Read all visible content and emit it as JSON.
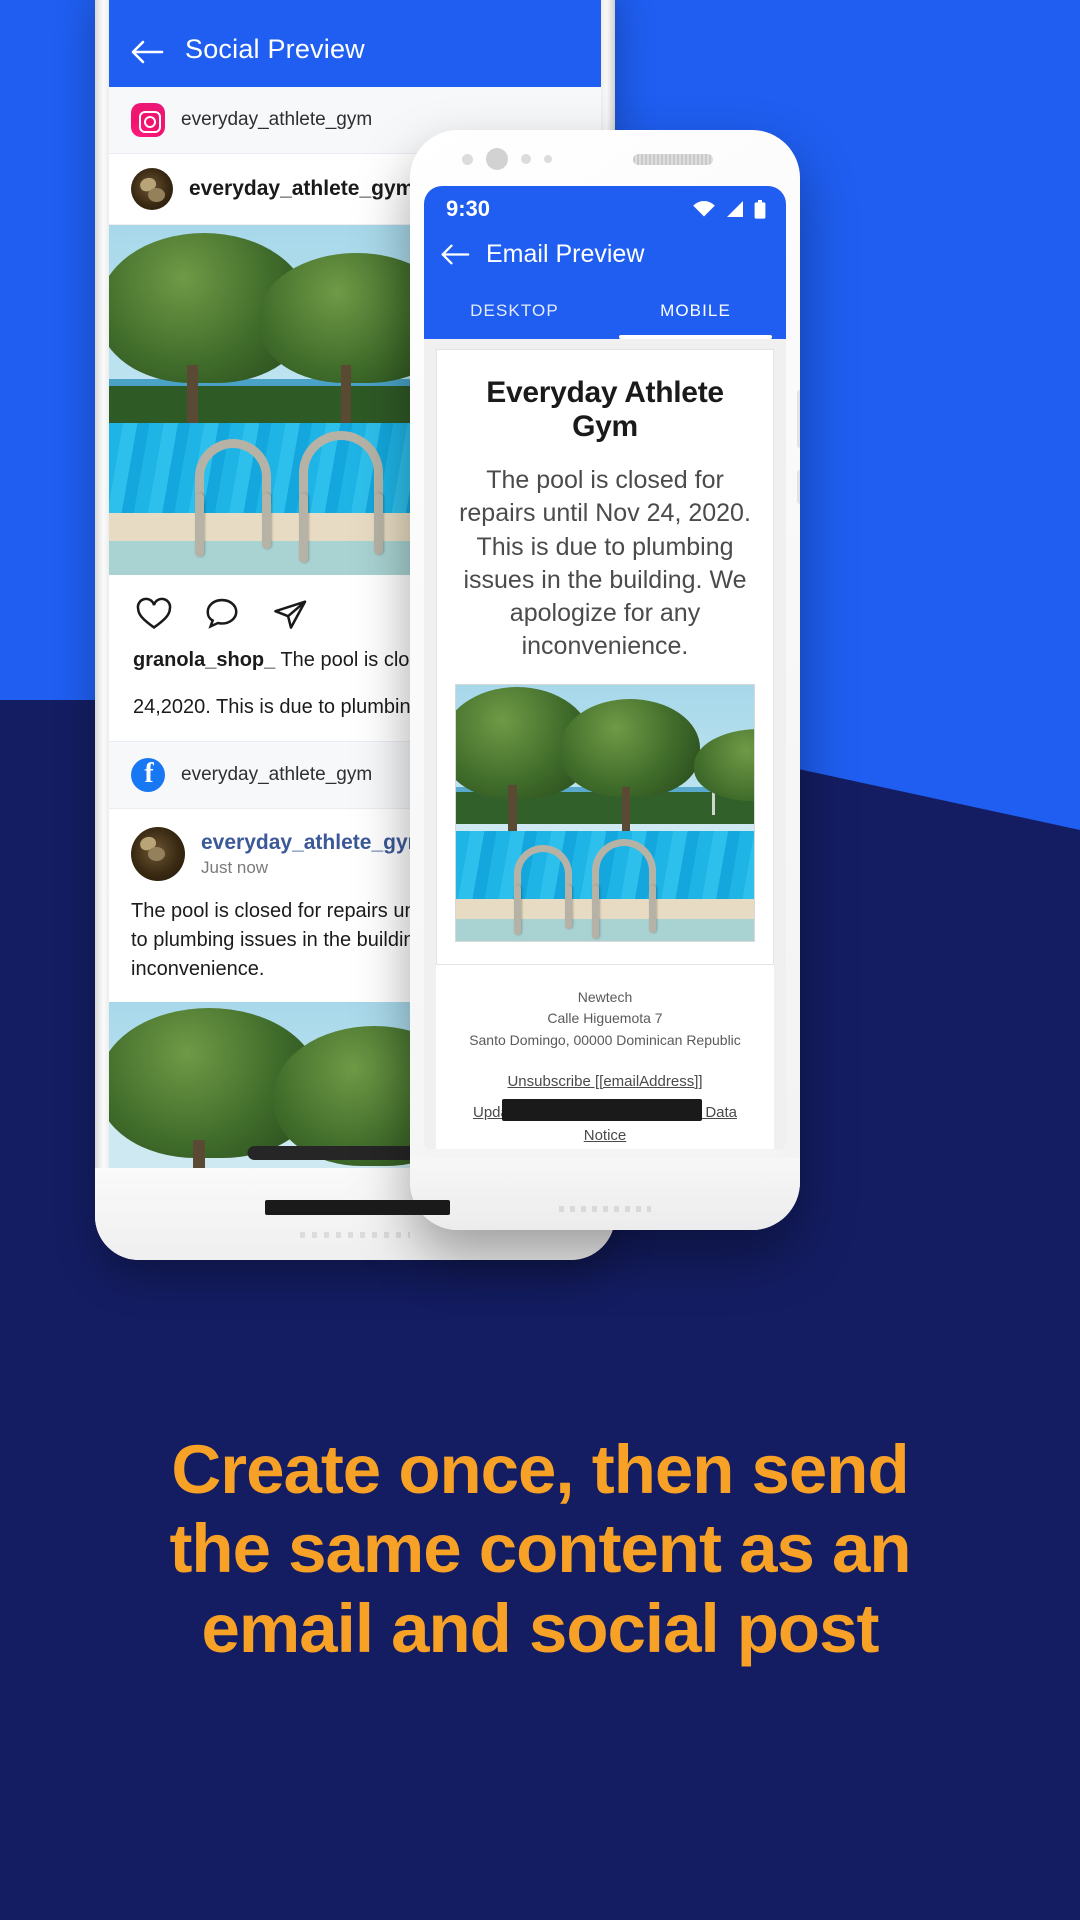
{
  "theme": {
    "brand_blue": "#1f5ef0",
    "navy": "#141d62",
    "headline_orange": "#f7a126",
    "instagram_pink": "#ef1671",
    "facebook_blue": "#1877f2"
  },
  "phone_social": {
    "appbar": {
      "back_icon": "arrow-left-icon",
      "title": "Social Preview"
    },
    "instagram": {
      "network_icon": "instagram-icon",
      "network_handle": "everyday_athlete_gym",
      "post_username": "everyday_athlete_gym",
      "avatar": "user-avatar",
      "actions": [
        "heart-icon",
        "comment-icon",
        "share-icon"
      ],
      "caption_author": "granola_shop_",
      "caption_line1": " The pool is closed for repairs until Nov",
      "caption_line2": "24,2020. This is due to plumbing issues in the"
    },
    "facebook": {
      "network_icon": "facebook-icon",
      "network_handle": "everyday_athlete_gym",
      "post_username": "everyday_athlete_gym",
      "timestamp": "Just now",
      "body_line1": "The pool is closed for repairs until Nov 24, 2020. This is due",
      "body_line2": "to plumbing issues in the building. We apologize for any",
      "body_line3": "inconvenience."
    }
  },
  "phone_email": {
    "status": {
      "time": "9:30",
      "icons": [
        "wifi-icon",
        "signal-icon",
        "battery-icon"
      ]
    },
    "appbar": {
      "back_icon": "arrow-left-icon",
      "title": "Email Preview"
    },
    "tabs": [
      {
        "label": "DESKTOP",
        "active": false
      },
      {
        "label": "MOBILE",
        "active": true
      }
    ],
    "email": {
      "heading": "Everyday Athlete Gym",
      "body": "The pool is closed for repairs until Nov 24, 2020. This is due to plumbing issues in the building. We apologize for any inconvenience.",
      "hero_image": "pool-photo",
      "footer_company": "Newtech",
      "footer_street": "Calle Higuemota 7",
      "footer_city": "Santo Domingo, 00000 Dominican Republic",
      "unsubscribe_link": "Unsubscribe [[emailAddress]]",
      "update_link": "Update Profile",
      "separator": " | ",
      "contact_link": "Customer Contact Data Notice"
    }
  },
  "headline": {
    "line1": "Create once, then send",
    "line2": "the same content as an",
    "line3": "email and social post"
  }
}
